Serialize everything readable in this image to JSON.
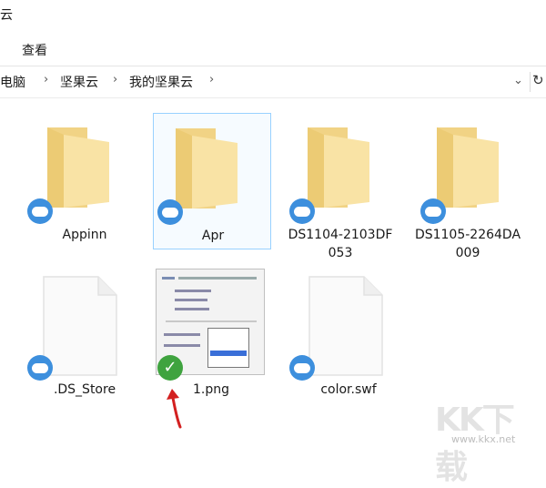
{
  "window": {
    "title": "云"
  },
  "ribbon": {
    "tab_view": "查看"
  },
  "breadcrumb": {
    "items": [
      "此电脑",
      "坚果云",
      "我的坚果云"
    ],
    "separator": "›"
  },
  "files": [
    {
      "label": "Appinn",
      "type": "folder"
    },
    {
      "label": "Apr",
      "type": "folder",
      "selected": true
    },
    {
      "label": "DS1104-2103DF053",
      "type": "folder"
    },
    {
      "label": "DS1105-2264DA009",
      "type": "folder"
    },
    {
      "label": ".DS_Store",
      "type": "file"
    },
    {
      "label": "1.png",
      "type": "image"
    },
    {
      "label": "color.swf",
      "type": "file"
    }
  ],
  "icons": {
    "sync": "cloud-icon",
    "synced": "check-icon",
    "arrow": "red-arrow-icon"
  },
  "colors": {
    "folder": "#f7dc8f",
    "cloud": "#3d8fdd",
    "check": "#3fa33f",
    "arrow": "#d32020",
    "selection": "#99d1ff"
  },
  "watermark": {
    "logo": "KK下载",
    "url": "www.kkx.net"
  }
}
